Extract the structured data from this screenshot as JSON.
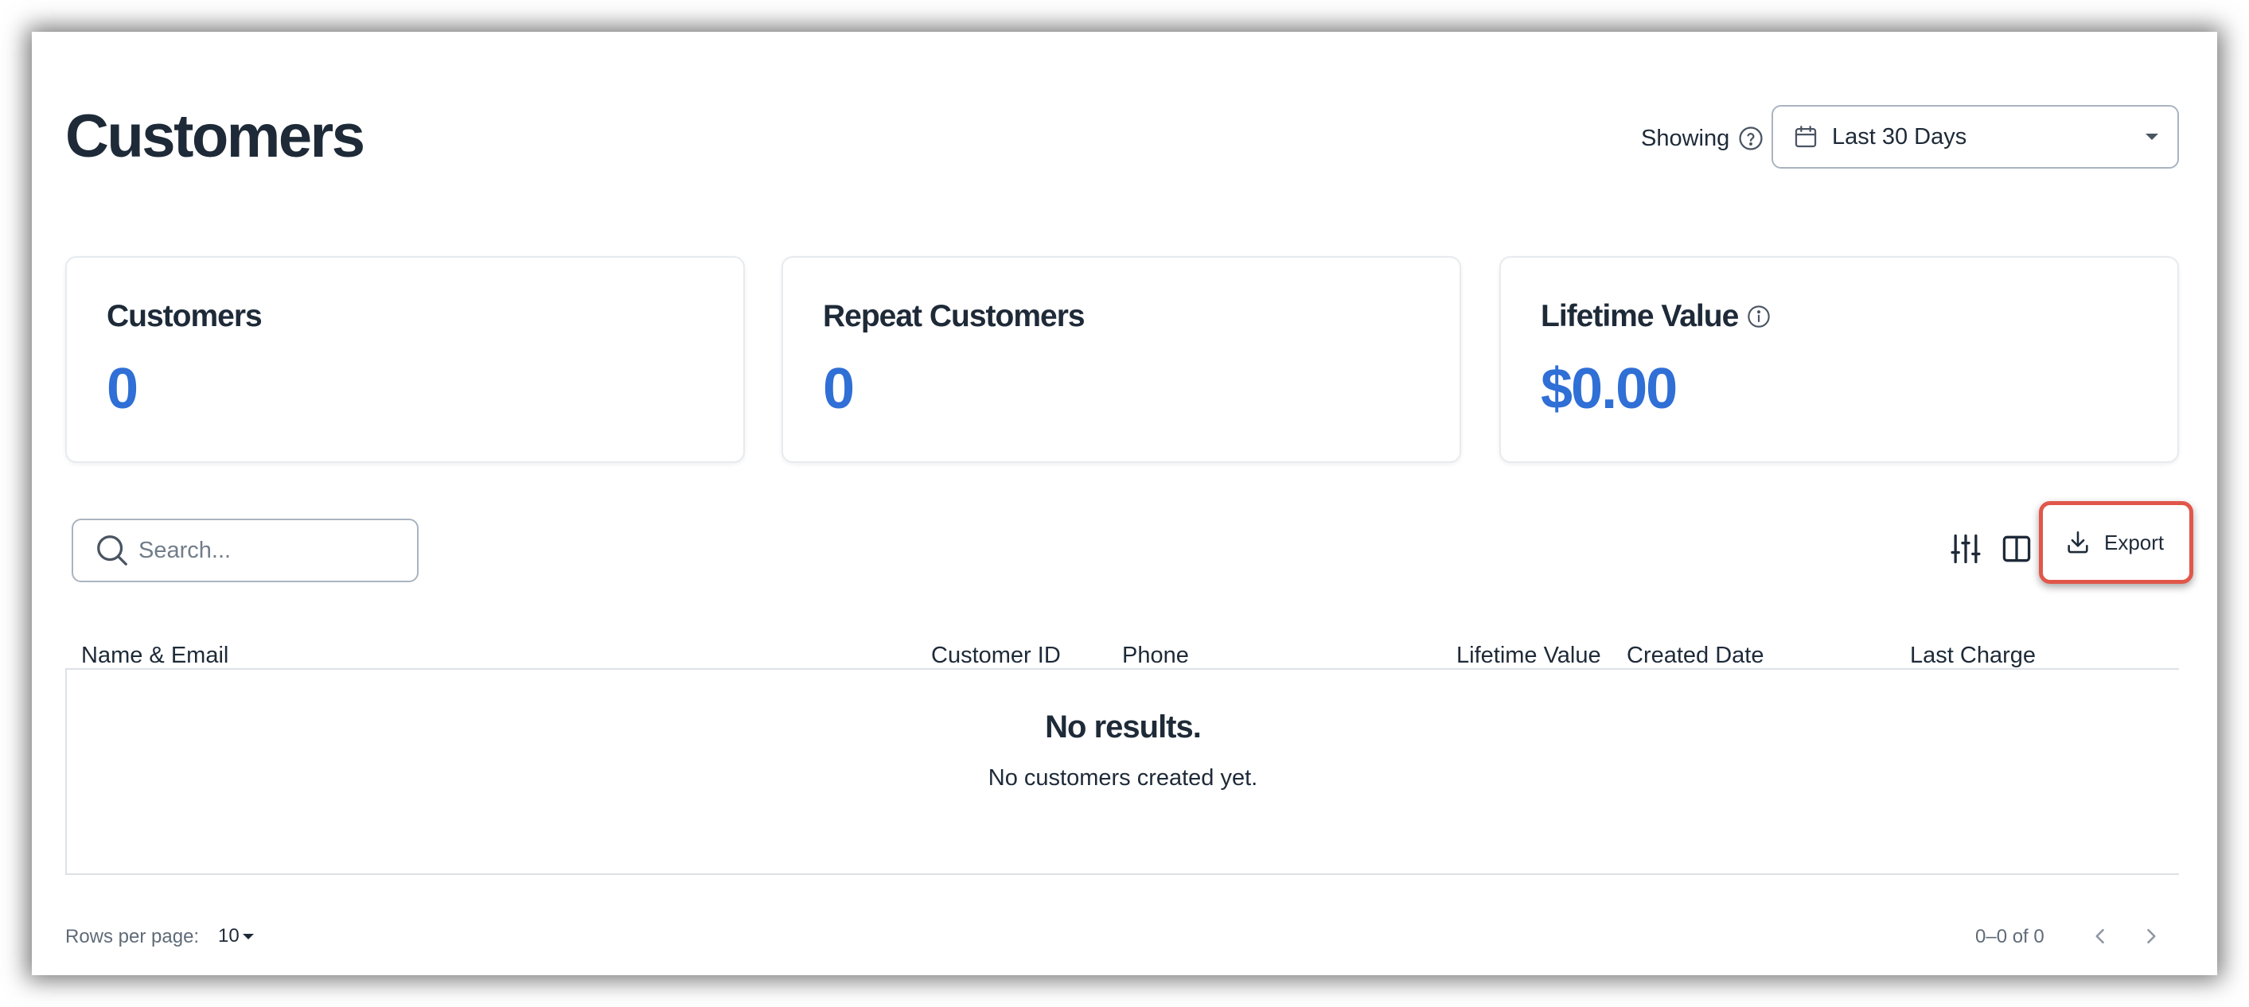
{
  "header": {
    "title": "Customers",
    "showing_label": "Showing",
    "date_range": "Last 30 Days"
  },
  "stats": [
    {
      "title": "Customers",
      "value": "0"
    },
    {
      "title": "Repeat Customers",
      "value": "0"
    },
    {
      "title": "Lifetime Value",
      "value": "$0.00"
    }
  ],
  "toolbar": {
    "search_placeholder": "Search...",
    "export_label": "Export"
  },
  "table": {
    "columns": [
      "Name & Email",
      "Customer ID",
      "Phone",
      "Lifetime Value",
      "Created Date",
      "Last Charge"
    ],
    "empty_title": "No results.",
    "empty_subtitle": "No customers created yet."
  },
  "pagination": {
    "rows_per_page_label": "Rows per page:",
    "rows_per_page": "10",
    "range": "0–0 of 0"
  },
  "colors": {
    "accent": "#2f6fd6",
    "highlight": "#e0574a",
    "text": "#1e2a38"
  },
  "icons": {
    "help": "help-circle-icon",
    "calendar": "calendar-icon",
    "info": "info-circle-icon",
    "search": "search-icon",
    "filters": "sliders-icon",
    "columns": "columns-icon",
    "export": "download-icon",
    "prev": "chevron-left-icon",
    "next": "chevron-right-icon"
  }
}
